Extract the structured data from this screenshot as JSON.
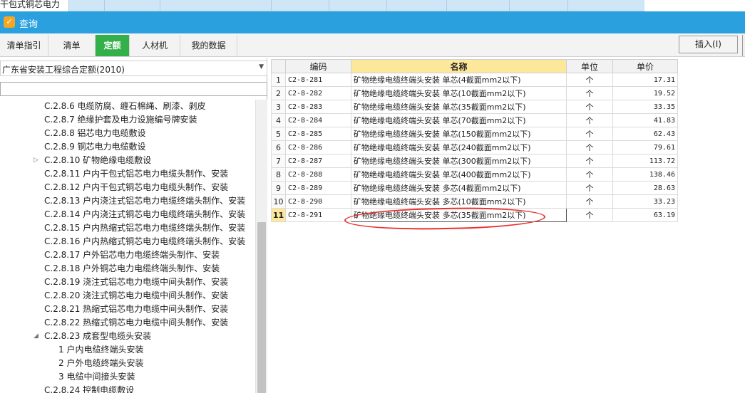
{
  "background_row": {
    "text": "干包式铜芯电力"
  },
  "window": {
    "title": "查询",
    "icon": "search-app-icon"
  },
  "tabs": [
    {
      "label": "清单指引",
      "active": false
    },
    {
      "label": "清单",
      "active": false
    },
    {
      "label": "定额",
      "active": true
    },
    {
      "label": "人材机",
      "active": false
    },
    {
      "label": "我的数据",
      "active": false
    }
  ],
  "toolbar": {
    "insert_label": "插入(I)"
  },
  "left": {
    "quota_select": {
      "value": "广东省安装工程综合定额(2010)"
    },
    "tree": [
      {
        "label": "C.2.8.6 电缆防腐、缠石棉绳、刷漆、剥皮",
        "level": 1,
        "expander": ""
      },
      {
        "label": "C.2.8.7 绝缘护套及电力设施编号牌安装",
        "level": 1,
        "expander": ""
      },
      {
        "label": "C.2.8.8 铝芯电力电缆敷设",
        "level": 1,
        "expander": ""
      },
      {
        "label": "C.2.8.9 铜芯电力电缆敷设",
        "level": 1,
        "expander": ""
      },
      {
        "label": "C.2.8.10 矿物绝缘电缆敷设",
        "level": 1,
        "expander": "▷"
      },
      {
        "label": "C.2.8.11 户内干包式铝芯电力电缆头制作、安装",
        "level": 1,
        "expander": ""
      },
      {
        "label": "C.2.8.12 户内干包式铜芯电力电缆头制作、安装",
        "level": 1,
        "expander": ""
      },
      {
        "label": "C.2.8.13 户内浇注式铝芯电力电缆终端头制作、安装",
        "level": 1,
        "expander": ""
      },
      {
        "label": "C.2.8.14 户内浇注式铜芯电力电缆终端头制作、安装",
        "level": 1,
        "expander": ""
      },
      {
        "label": "C.2.8.15 户内热缩式铝芯电力电缆终端头制作、安装",
        "level": 1,
        "expander": ""
      },
      {
        "label": "C.2.8.16 户内热缩式铜芯电力电缆终端头制作、安装",
        "level": 1,
        "expander": ""
      },
      {
        "label": "C.2.8.17 户外铝芯电力电缆终端头制作、安装",
        "level": 1,
        "expander": ""
      },
      {
        "label": "C.2.8.18 户外铜芯电力电缆终端头制作、安装",
        "level": 1,
        "expander": ""
      },
      {
        "label": "C.2.8.19 浇注式铝芯电力电缆中间头制作、安装",
        "level": 1,
        "expander": ""
      },
      {
        "label": "C.2.8.20 浇注式铜芯电力电缆中间头制作、安装",
        "level": 1,
        "expander": ""
      },
      {
        "label": "C.2.8.21 热缩式铝芯电力电缆中间头制作、安装",
        "level": 1,
        "expander": ""
      },
      {
        "label": "C.2.8.22 热缩式铜芯电力电缆中间头制作、安装",
        "level": 1,
        "expander": ""
      },
      {
        "label": "C.2.8.23 成套型电缆头安装",
        "level": 1,
        "expander": "◢"
      },
      {
        "label": "1 户内电缆终端头安装",
        "level": 2,
        "expander": ""
      },
      {
        "label": "2 户外电缆终端头安装",
        "level": 2,
        "expander": ""
      },
      {
        "label": "3 电缆中间接头安装",
        "level": 2,
        "expander": ""
      },
      {
        "label": "C.2.8.24 控制电缆敷设",
        "level": 1,
        "expander": ""
      }
    ]
  },
  "grid": {
    "columns": [
      "编码",
      "名称",
      "单位",
      "单价"
    ],
    "selected_column": "名称",
    "rows": [
      {
        "idx": "1",
        "code": "C2-8-281",
        "name": "矿物绝缘电缆终端头安装 单芯(4截面mm2以下)",
        "unit": "个",
        "price": "17.31"
      },
      {
        "idx": "2",
        "code": "C2-8-282",
        "name": "矿物绝缘电缆终端头安装 单芯(10截面mm2以下)",
        "unit": "个",
        "price": "19.52"
      },
      {
        "idx": "3",
        "code": "C2-8-283",
        "name": "矿物绝缘电缆终端头安装 单芯(35截面mm2以下)",
        "unit": "个",
        "price": "33.35"
      },
      {
        "idx": "4",
        "code": "C2-8-284",
        "name": "矿物绝缘电缆终端头安装 单芯(70截面mm2以下)",
        "unit": "个",
        "price": "41.83"
      },
      {
        "idx": "5",
        "code": "C2-8-285",
        "name": "矿物绝缘电缆终端头安装 单芯(150截面mm2以下)",
        "unit": "个",
        "price": "62.43"
      },
      {
        "idx": "6",
        "code": "C2-8-286",
        "name": "矿物绝缘电缆终端头安装 单芯(240截面mm2以下)",
        "unit": "个",
        "price": "79.61"
      },
      {
        "idx": "7",
        "code": "C2-8-287",
        "name": "矿物绝缘电缆终端头安装 单芯(300截面mm2以下)",
        "unit": "个",
        "price": "113.72"
      },
      {
        "idx": "8",
        "code": "C2-8-288",
        "name": "矿物绝缘电缆终端头安装 单芯(400截面mm2以下)",
        "unit": "个",
        "price": "138.46"
      },
      {
        "idx": "9",
        "code": "C2-8-289",
        "name": "矿物绝缘电缆终端头安装 多芯(4截面mm2以下)",
        "unit": "个",
        "price": "28.63"
      },
      {
        "idx": "10",
        "code": "C2-8-290",
        "name": "矿物绝缘电缆终端头安装 多芯(10截面mm2以下)",
        "unit": "个",
        "price": "33.23"
      },
      {
        "idx": "11",
        "code": "C2-8-291",
        "name": "矿物绝缘电缆终端头安装 多芯(35截面mm2以下)",
        "unit": "个",
        "price": "63.19",
        "current": true
      }
    ]
  },
  "colors": {
    "titlebar": "#2aa0df",
    "active_tab": "#33b04a",
    "selected_header": "#fde79a",
    "annotation": "#e8312d"
  }
}
